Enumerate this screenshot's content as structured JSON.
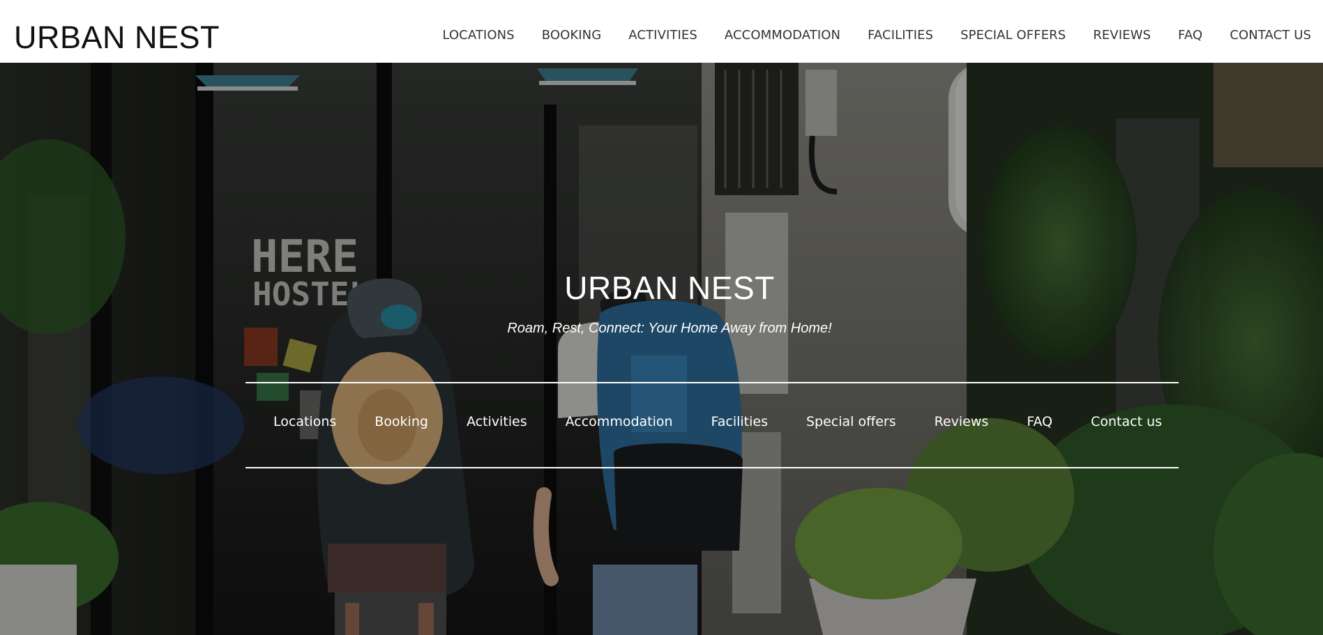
{
  "header": {
    "logo": "URBAN NEST",
    "nav": [
      "LOCATIONS",
      "BOOKING",
      "ACTIVITIES",
      "ACCOMMODATION",
      "FACILITIES",
      "SPECIAL OFFERS",
      "REVIEWS",
      "FAQ",
      "CONTACT US"
    ]
  },
  "hero": {
    "title": "URBAN NEST",
    "tagline": "Roam, Rest, Connect: Your Home Away from Home!",
    "photo_signs": [
      "HERE",
      "HOSTEL",
      "HERE"
    ],
    "nav": [
      "Locations",
      "Booking",
      "Activities",
      "Accommodation",
      "Facilities",
      "Special offers",
      "Reviews",
      "FAQ",
      "Contact us"
    ]
  },
  "colors": {
    "header_bg": "#ffffff",
    "logo_text": "#111111",
    "nav_text": "#333333",
    "hero_text": "#ffffff",
    "hero_rule": "#ffffff"
  }
}
